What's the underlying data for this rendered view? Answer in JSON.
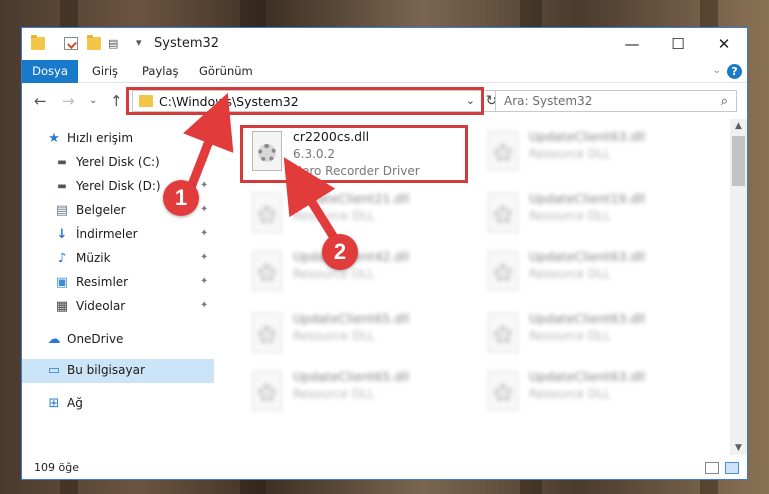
{
  "window": {
    "title": "System32",
    "controls": {
      "minimize": "—",
      "maximize": "☐",
      "close": "✕"
    }
  },
  "ribbon": {
    "tabs": [
      "Dosya",
      "Giriş",
      "Paylaş",
      "Görünüm"
    ],
    "help": "?"
  },
  "address": {
    "path": "C:\\Windows\\System32",
    "search_placeholder": "Ara: System32"
  },
  "sidebar": {
    "items": [
      {
        "label": "Hızlı erişim",
        "icon": "star-icon"
      },
      {
        "label": "Yerel Disk (C:)",
        "icon": "drive-icon"
      },
      {
        "label": "Yerel Disk (D:)",
        "icon": "drive-icon"
      },
      {
        "label": "Belgeler",
        "icon": "documents-icon"
      },
      {
        "label": "İndirmeler",
        "icon": "download-icon"
      },
      {
        "label": "Müzik",
        "icon": "music-icon"
      },
      {
        "label": "Resimler",
        "icon": "pictures-icon"
      },
      {
        "label": "Videolar",
        "icon": "video-icon"
      },
      {
        "label": "OneDrive",
        "icon": "cloud-icon"
      },
      {
        "label": "Bu bilgisayar",
        "icon": "computer-icon"
      },
      {
        "label": "Ağ",
        "icon": "network-icon"
      }
    ]
  },
  "files": {
    "highlighted": {
      "name": "cr2200cs.dll",
      "version": "6.3.0.2",
      "description": "Nero Recorder Driver"
    },
    "others": [
      {
        "name": "UpdateClient63.dll",
        "description": "Resource DLL"
      },
      {
        "name": "UpdateClient21.dll",
        "description": "Resource DLL"
      },
      {
        "name": "UpdateClient19.dll",
        "description": "Resource DLL"
      },
      {
        "name": "UpdateClient42.dll",
        "description": "Resource DLL"
      },
      {
        "name": "UpdateClient63.dll",
        "description": "Resource DLL"
      },
      {
        "name": "UpdateClient65.dll",
        "description": "Resource DLL"
      },
      {
        "name": "UpdateClient63.dll",
        "description": "Resource DLL"
      },
      {
        "name": "UpdateClient65.dll",
        "description": "Resource DLL"
      },
      {
        "name": "UpdateClient63.dll",
        "description": "Resource DLL"
      }
    ]
  },
  "status": {
    "item_count": "109 öğe"
  },
  "callouts": [
    "1",
    "2"
  ],
  "colors": {
    "accent": "#1979ca",
    "highlight": "#d33b3b",
    "selected": "#cce4f7"
  }
}
